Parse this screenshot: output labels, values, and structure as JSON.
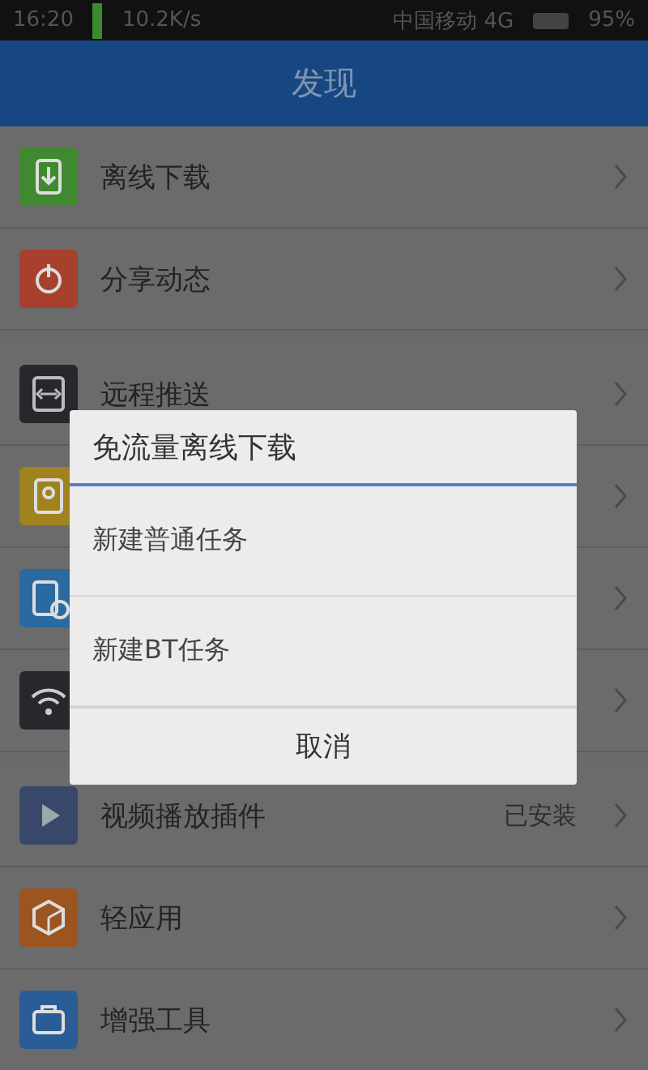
{
  "status_bar": {
    "time": "16:20",
    "speed": "10.2K/s",
    "carrier": "中国移动 4G",
    "battery": "95%"
  },
  "header": {
    "title": "发现"
  },
  "sections": [
    {
      "items": [
        {
          "label": "离线下载",
          "color": "#3f8a2e"
        },
        {
          "label": "分享动态",
          "color": "#a8402e"
        }
      ]
    },
    {
      "items": [
        {
          "label": "远程推送",
          "color": "#26282c"
        },
        {
          "color": "#a0821e"
        },
        {
          "color": "#2a6aa0"
        },
        {
          "color": "#26282c"
        }
      ]
    },
    {
      "items": [
        {
          "label": "视频播放插件",
          "detail": "已安装",
          "color": "#39486a"
        },
        {
          "label": "轻应用",
          "color": "#9c5420"
        },
        {
          "label": "增强工具",
          "color": "#2a5c96"
        }
      ]
    }
  ],
  "dialog": {
    "title": "免流量离线下载",
    "options": [
      "新建普通任务",
      "新建BT任务"
    ],
    "cancel": "取消"
  }
}
